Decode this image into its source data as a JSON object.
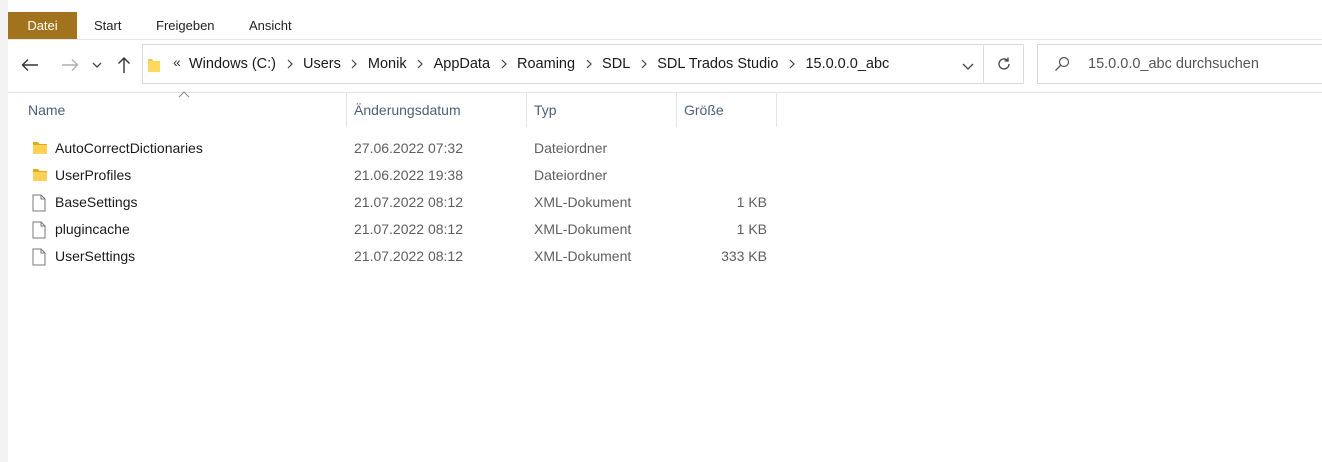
{
  "ribbon": {
    "tabs": [
      "Datei",
      "Start",
      "Freigeben",
      "Ansicht"
    ]
  },
  "nav": {
    "breadcrumbs": [
      "Windows (C:)",
      "Users",
      "Monik",
      "AppData",
      "Roaming",
      "SDL",
      "SDL Trados Studio",
      "15.0.0.0_abc"
    ],
    "overflow_glyph": "«"
  },
  "search": {
    "placeholder": "15.0.0.0_abc durchsuchen"
  },
  "columns": {
    "name": "Name",
    "date": "Änderungsdatum",
    "type": "Typ",
    "size": "Größe"
  },
  "files": [
    {
      "name": "AutoCorrectDictionaries",
      "date": "27.06.2022 07:32",
      "type": "Dateiordner",
      "size": "",
      "icon": "folder-icon"
    },
    {
      "name": "UserProfiles",
      "date": "21.06.2022 19:38",
      "type": "Dateiordner",
      "size": "",
      "icon": "folder-icon"
    },
    {
      "name": "BaseSettings",
      "date": "21.07.2022 08:12",
      "type": "XML-Dokument",
      "size": "1 KB",
      "icon": "file-icon"
    },
    {
      "name": "plugincache",
      "date": "21.07.2022 08:12",
      "type": "XML-Dokument",
      "size": "1 KB",
      "icon": "file-icon"
    },
    {
      "name": "UserSettings",
      "date": "21.07.2022 08:12",
      "type": "XML-Dokument",
      "size": "333 KB",
      "icon": "file-icon"
    }
  ],
  "colors": {
    "file_tab": "#a0731c",
    "folder": "#f1c84b",
    "header_text": "#4c607a"
  }
}
